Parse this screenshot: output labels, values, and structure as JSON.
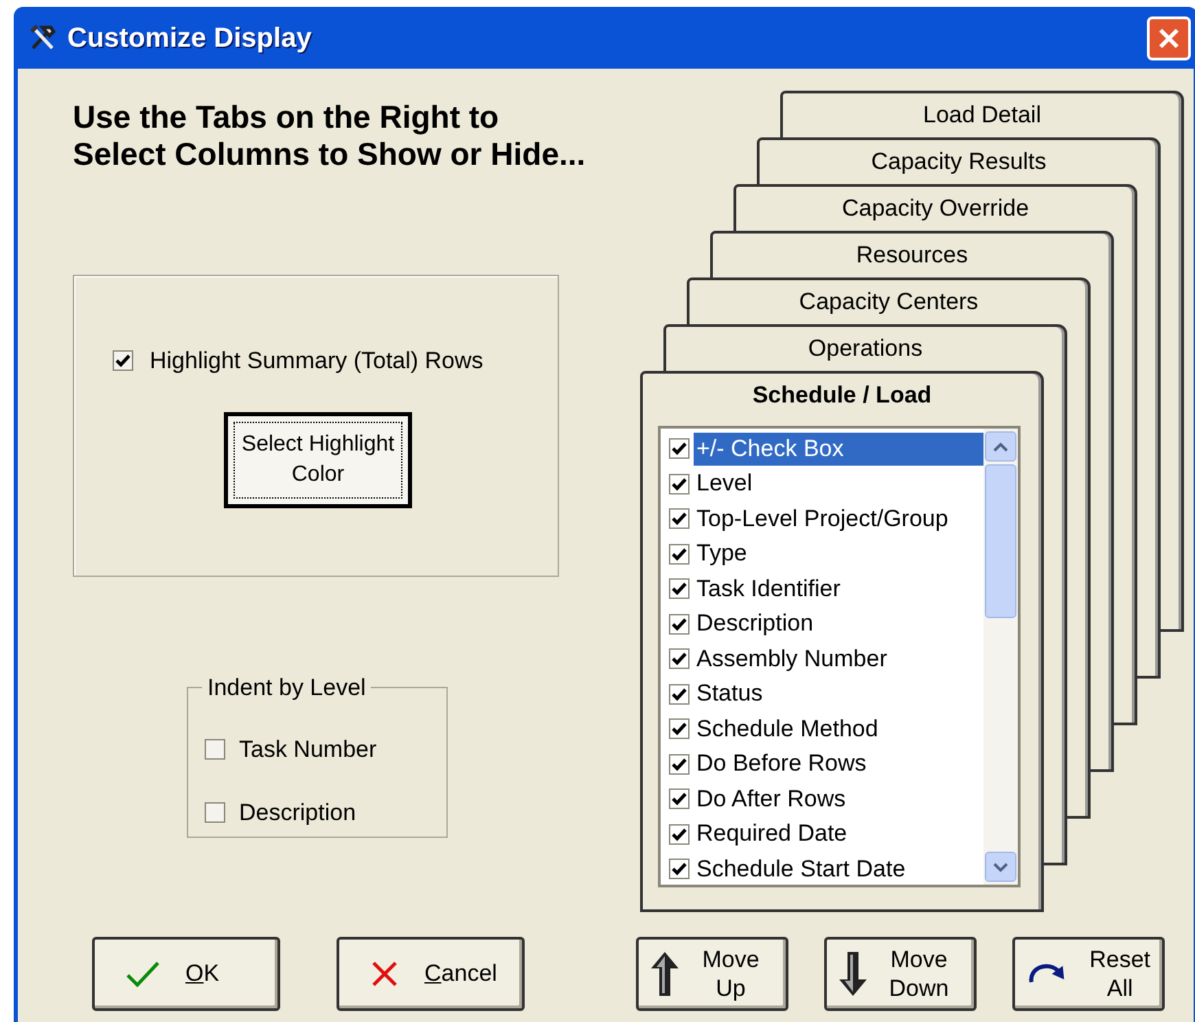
{
  "window": {
    "title": "Customize Display"
  },
  "heading_lines": [
    "Use the Tabs on the Right to",
    "Select Columns to Show or Hide..."
  ],
  "highlight": {
    "label": "Highlight Summary (Total) Rows",
    "checked": true,
    "button": "Select Highlight Color"
  },
  "indent_group": {
    "title": "Indent by Level",
    "options": [
      {
        "label": "Task Number",
        "checked": false
      },
      {
        "label": "Description",
        "checked": false
      }
    ]
  },
  "tabs": [
    {
      "label": "Load Detail",
      "selected": false
    },
    {
      "label": "Capacity Results",
      "selected": false
    },
    {
      "label": "Capacity Override",
      "selected": false
    },
    {
      "label": "Resources",
      "selected": false
    },
    {
      "label": "Capacity Centers",
      "selected": false
    },
    {
      "label": "Operations",
      "selected": false
    },
    {
      "label": "Schedule / Load",
      "selected": true
    }
  ],
  "columns": [
    {
      "label": "+/- Check Box",
      "checked": true,
      "selected": true
    },
    {
      "label": "Level",
      "checked": true,
      "selected": false
    },
    {
      "label": "Top-Level Project/Group",
      "checked": true,
      "selected": false
    },
    {
      "label": "Type",
      "checked": true,
      "selected": false
    },
    {
      "label": "Task Identifier",
      "checked": true,
      "selected": false
    },
    {
      "label": "Description",
      "checked": true,
      "selected": false
    },
    {
      "label": "Assembly Number",
      "checked": true,
      "selected": false
    },
    {
      "label": "Status",
      "checked": true,
      "selected": false
    },
    {
      "label": "Schedule Method",
      "checked": true,
      "selected": false
    },
    {
      "label": "Do Before Rows",
      "checked": true,
      "selected": false
    },
    {
      "label": "Do After Rows",
      "checked": true,
      "selected": false
    },
    {
      "label": "Required Date",
      "checked": true,
      "selected": false
    },
    {
      "label": "Schedule Start Date",
      "checked": true,
      "selected": false
    }
  ],
  "buttons": [
    {
      "kind": "ok",
      "label": "OK",
      "mnemonic": true
    },
    {
      "kind": "cancel",
      "label": "Cancel",
      "mnemonic": true
    },
    {
      "kind": "up",
      "label": "Move Up",
      "mnemonic": false
    },
    {
      "kind": "down",
      "label": "Move Down",
      "mnemonic": false
    },
    {
      "kind": "reset",
      "label": "Reset All",
      "mnemonic": false
    }
  ]
}
